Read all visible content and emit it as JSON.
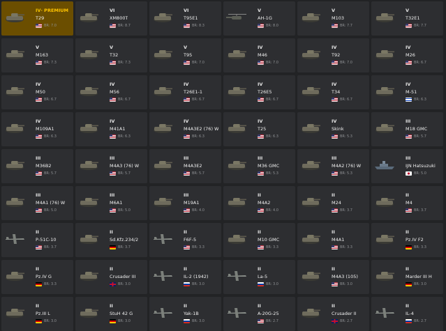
{
  "labels": {
    "br_prefix": "BR"
  },
  "vehicles": [
    {
      "tier": "IV",
      "premium_label": "· PREMIUM",
      "name": "T29",
      "flag": "usa",
      "br": "7.0",
      "premium": true,
      "kind": "tank"
    },
    {
      "tier": "VI",
      "name": "XM800T",
      "flag": "usa",
      "br": "8.7",
      "kind": "tank"
    },
    {
      "tier": "VI",
      "name": "T95E1",
      "flag": "usa",
      "br": "8.3",
      "kind": "tank"
    },
    {
      "tier": "V",
      "name": "AH-1G",
      "flag": "usa",
      "br": "8.0",
      "kind": "heli"
    },
    {
      "tier": "V",
      "name": "M103",
      "flag": "usa",
      "br": "7.7",
      "kind": "tank"
    },
    {
      "tier": "V",
      "name": "T32E1",
      "flag": "usa",
      "br": "7.7",
      "kind": "tank"
    },
    {
      "tier": "V",
      "name": "M163",
      "flag": "usa",
      "br": "7.3",
      "kind": "tank"
    },
    {
      "tier": "V",
      "name": "T32",
      "flag": "usa",
      "br": "7.3",
      "kind": "tank"
    },
    {
      "tier": "V",
      "name": "T95",
      "flag": "usa",
      "br": "7.0",
      "kind": "tank"
    },
    {
      "tier": "IV",
      "name": "M46",
      "flag": "usa",
      "br": "7.0",
      "kind": "tank"
    },
    {
      "tier": "IV",
      "name": "T92",
      "flag": "usa",
      "br": "7.0",
      "kind": "tank"
    },
    {
      "tier": "IV",
      "name": "M26",
      "flag": "usa",
      "br": "6.7",
      "kind": "tank"
    },
    {
      "tier": "IV",
      "name": "M50",
      "flag": "usa",
      "br": "6.7",
      "kind": "tank"
    },
    {
      "tier": "IV",
      "name": "M56",
      "flag": "usa",
      "br": "6.7",
      "kind": "tank"
    },
    {
      "tier": "IV",
      "name": "T26E1-1",
      "flag": "usa",
      "br": "6.7",
      "kind": "tank"
    },
    {
      "tier": "IV",
      "name": "T26E5",
      "flag": "usa",
      "br": "6.7",
      "kind": "tank"
    },
    {
      "tier": "IV",
      "name": "T34",
      "flag": "usa",
      "br": "6.7",
      "kind": "tank"
    },
    {
      "tier": "IV",
      "name": "M-51",
      "flag": "israel",
      "br": "6.3",
      "kind": "tank"
    },
    {
      "tier": "IV",
      "name": "M109A1",
      "flag": "usa",
      "br": "6.3",
      "kind": "tank"
    },
    {
      "tier": "IV",
      "name": "M41A1",
      "flag": "usa",
      "br": "6.3",
      "kind": "tank"
    },
    {
      "tier": "IV",
      "name": "M4A3E2 (76) W",
      "flag": "usa",
      "br": "6.3",
      "kind": "tank"
    },
    {
      "tier": "IV",
      "name": "T25",
      "flag": "usa",
      "br": "6.3",
      "kind": "tank"
    },
    {
      "tier": "IV",
      "name": "Skink",
      "flag": "usa",
      "br": "5.3",
      "kind": "tank"
    },
    {
      "tier": "III",
      "name": "M18 GMC",
      "flag": "usa",
      "br": "5.7",
      "kind": "tank"
    },
    {
      "tier": "III",
      "name": "M36B2",
      "flag": "usa",
      "br": "5.7",
      "kind": "tank"
    },
    {
      "tier": "III",
      "name": "M4A3 (76) W",
      "flag": "usa",
      "br": "5.7",
      "kind": "tank"
    },
    {
      "tier": "III",
      "name": "M4A3E2",
      "flag": "usa",
      "br": "5.7",
      "kind": "tank"
    },
    {
      "tier": "III",
      "name": "M36 GMC",
      "flag": "usa",
      "br": "5.3",
      "kind": "tank"
    },
    {
      "tier": "III",
      "name": "M4A2 (76) W",
      "flag": "usa",
      "br": "5.3",
      "kind": "tank"
    },
    {
      "tier": "III",
      "name": "IJN Hatsuzuki",
      "flag": "japan",
      "br": "5.0",
      "kind": "ship"
    },
    {
      "tier": "III",
      "name": "M4A1 (76) W",
      "flag": "usa",
      "br": "5.0",
      "kind": "tank"
    },
    {
      "tier": "III",
      "name": "M6A1",
      "flag": "usa",
      "br": "5.0",
      "kind": "tank"
    },
    {
      "tier": "III",
      "name": "M19A1",
      "flag": "usa",
      "br": "4.0",
      "kind": "tank"
    },
    {
      "tier": "II",
      "name": "M4A2",
      "flag": "usa",
      "br": "4.0",
      "kind": "tank"
    },
    {
      "tier": "II",
      "name": "M24",
      "flag": "usa",
      "br": "3.7",
      "kind": "tank"
    },
    {
      "tier": "II",
      "name": "M4",
      "flag": "usa",
      "br": "3.7",
      "kind": "tank"
    },
    {
      "tier": "II",
      "name": "P-51C-10",
      "flag": "usa",
      "br": "3.7",
      "kind": "plane"
    },
    {
      "tier": "II",
      "name": "Sd.Kfz.234/2",
      "flag": "germany",
      "br": "3.7",
      "kind": "tank"
    },
    {
      "tier": "II",
      "name": "F6F-5",
      "flag": "usa",
      "br": "3.3",
      "kind": "plane"
    },
    {
      "tier": "II",
      "name": "M10 GMC",
      "flag": "usa",
      "br": "3.3",
      "kind": "tank"
    },
    {
      "tier": "II",
      "name": "M4A1",
      "flag": "usa",
      "br": "3.3",
      "kind": "tank"
    },
    {
      "tier": "II",
      "name": "Pz.IV F2",
      "flag": "germany",
      "br": "3.3",
      "kind": "tank"
    },
    {
      "tier": "II",
      "name": "Pz.IV G",
      "flag": "germany",
      "br": "3.3",
      "kind": "tank"
    },
    {
      "tier": "II",
      "name": "Crusader III",
      "flag": "uk",
      "br": "3.0",
      "kind": "tank"
    },
    {
      "tier": "II",
      "name": "IL-2 (1942)",
      "flag": "ussr",
      "br": "3.0",
      "kind": "plane"
    },
    {
      "tier": "II",
      "name": "La-5",
      "flag": "ussr",
      "br": "3.0",
      "kind": "plane"
    },
    {
      "tier": "II",
      "name": "M4A3 (105)",
      "flag": "usa",
      "br": "3.0",
      "kind": "tank"
    },
    {
      "tier": "II",
      "name": "Marder III H",
      "flag": "germany",
      "br": "3.0",
      "kind": "tank"
    },
    {
      "tier": "II",
      "name": "Pz.III L",
      "flag": "germany",
      "br": "3.0",
      "kind": "tank"
    },
    {
      "tier": "II",
      "name": "StuH 42 G",
      "flag": "germany",
      "br": "3.0",
      "kind": "tank"
    },
    {
      "tier": "II",
      "name": "Yak-1B",
      "flag": "ussr",
      "br": "3.0",
      "kind": "plane"
    },
    {
      "tier": "II",
      "name": "A-20G-25",
      "flag": "usa",
      "br": "2.7",
      "kind": "plane"
    },
    {
      "tier": "II",
      "name": "Crusader II",
      "flag": "uk",
      "br": "2.7",
      "kind": "tank"
    },
    {
      "tier": "II",
      "name": "IL-4",
      "flag": "ussr",
      "br": "2.7",
      "kind": "plane"
    }
  ]
}
